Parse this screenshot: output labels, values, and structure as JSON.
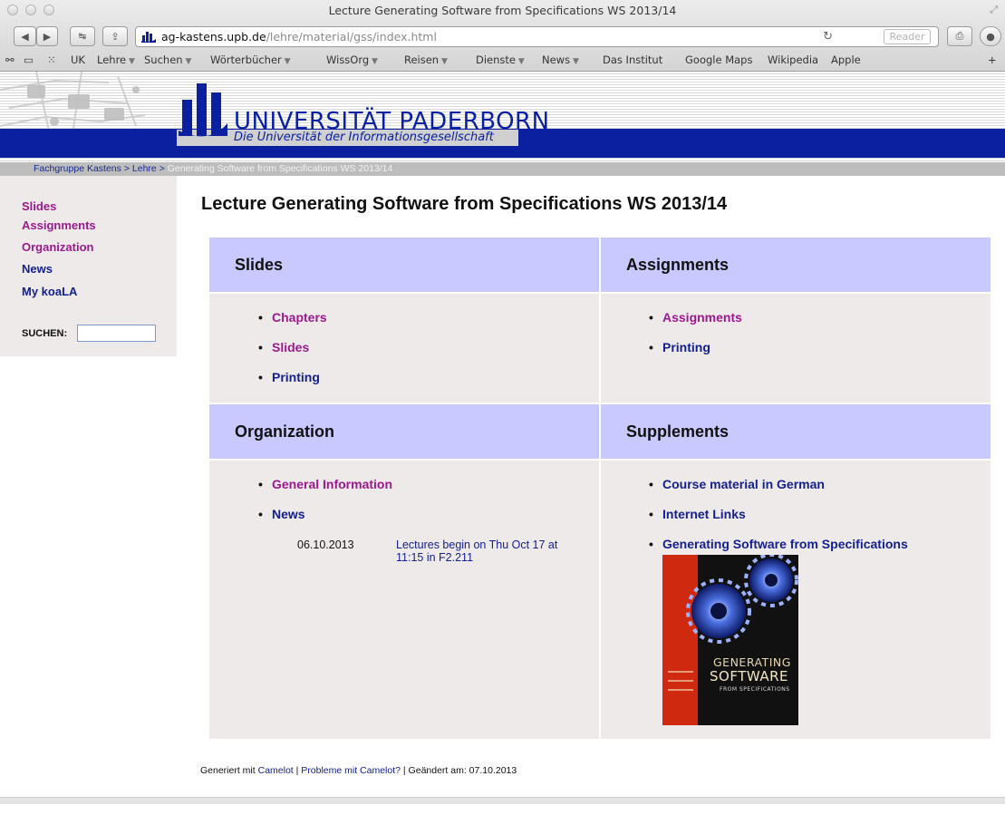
{
  "window": {
    "title": "Lecture Generating Software from Specifications WS 2013/14"
  },
  "toolbar": {
    "back_icon": "back-arrow-icon",
    "forward_icon": "forward-arrow-icon",
    "url_host": "ag-kastens.upb.de",
    "url_path": "/lehre/material/gss/index.html",
    "reader_label": "Reader"
  },
  "bookmarks": [
    {
      "label": "UK",
      "menu": false
    },
    {
      "label": "Lehre",
      "menu": true
    },
    {
      "label": "Suchen",
      "menu": true
    },
    {
      "label": "Wörterbücher",
      "menu": true
    },
    {
      "label": "WissOrg",
      "menu": true
    },
    {
      "label": "Reisen",
      "menu": true
    },
    {
      "label": "Dienste",
      "menu": true
    },
    {
      "label": "News",
      "menu": true
    },
    {
      "label": "Das Institut",
      "menu": false
    },
    {
      "label": "Google Maps",
      "menu": false
    },
    {
      "label": "Wikipedia",
      "menu": false
    },
    {
      "label": "Apple",
      "menu": false
    }
  ],
  "banner": {
    "university": "UNIVERSITÄT PADERBORN",
    "tagline": "Die Universität der Informationsgesellschaft"
  },
  "breadcrumb": {
    "items": [
      "Fachgruppe Kastens",
      "Lehre"
    ],
    "separator": ">",
    "current": "Generating Software from Specifications WS 2013/14"
  },
  "sidebar": {
    "links": [
      {
        "label": "Slides",
        "color": "purple"
      },
      {
        "label": "Assignments",
        "color": "purple"
      },
      {
        "label": "Organization",
        "color": "purple"
      },
      {
        "label": "News",
        "color": "navy"
      },
      {
        "label": "My koaLA",
        "color": "navy"
      }
    ],
    "search_label": "SUCHEN:",
    "search_value": ""
  },
  "main": {
    "title": "Lecture Generating Software from Specifications WS 2013/14",
    "sections": {
      "slides": {
        "heading": "Slides",
        "links": [
          {
            "label": "Chapters",
            "color": "purple"
          },
          {
            "label": "Slides",
            "color": "purple"
          },
          {
            "label": "Printing",
            "color": "navy"
          }
        ]
      },
      "assignments": {
        "heading": "Assignments",
        "links": [
          {
            "label": "Assignments",
            "color": "purple"
          },
          {
            "label": "Printing",
            "color": "navy"
          }
        ]
      },
      "organization": {
        "heading": "Organization",
        "links": [
          {
            "label": "General Information",
            "color": "purple"
          },
          {
            "label": "News",
            "color": "navy"
          }
        ],
        "news": {
          "date": "06.10.2013",
          "text": "Lectures begin on Thu Oct 17 at 11:15 in F2.211"
        }
      },
      "supplements": {
        "heading": "Supplements",
        "links": [
          {
            "label": "Course material in German",
            "color": "navy"
          },
          {
            "label": "Internet Links",
            "color": "navy"
          },
          {
            "label": "Generating Software from Specifications",
            "color": "navy"
          }
        ],
        "book": {
          "line1": "GENERATING",
          "line2": "SOFTWARE",
          "line3": "FROM SPECIFICATIONS"
        }
      }
    }
  },
  "footer": {
    "prefix": "Generiert mit ",
    "camelot_link": "Camelot",
    "sep1": " | ",
    "problems_link": "Probleme mit Camelot?",
    "suffix": " | Geändert am: 07.10.2013"
  },
  "colors": {
    "purple": "#9a1a8c",
    "navy": "#14208c",
    "header_blue": "#0a20a0",
    "cell_head": "#c9c9ff",
    "cell_body": "#efeaea"
  }
}
